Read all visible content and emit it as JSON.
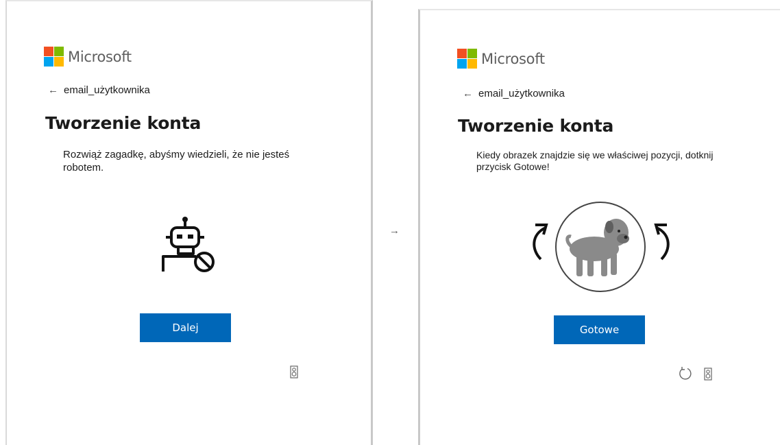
{
  "flow_arrow": "→",
  "step1": {
    "brand": "Microsoft",
    "back_glyph": "←",
    "account": "email_użytkownika",
    "title": "Tworzenie konta",
    "instruction": "Rozwiąż zagadkę, abyśmy wiedzieli, że nie jesteś robotem.",
    "icon": "robot-no-icon",
    "button_label": "Dalej",
    "audio_icon": "audio-device-icon"
  },
  "step2": {
    "brand": "Microsoft",
    "back_glyph": "←",
    "account": "email_użytkownika",
    "title": "Tworzenie konta",
    "instruction": "Kiedy obrazek znajdzie się we właściwej pozycji, dotknij przycisk Gotowe!",
    "image": "dog-image",
    "rotate_left_icon": "rotate-left-icon",
    "rotate_right_icon": "rotate-right-icon",
    "button_label": "Gotowe",
    "refresh_icon": "refresh-icon",
    "audio_icon": "audio-device-icon"
  },
  "colors": {
    "button": "#0067b8",
    "ms_red": "#f25022",
    "ms_green": "#7fba00",
    "ms_blue": "#00a4ef",
    "ms_yellow": "#ffb900"
  }
}
